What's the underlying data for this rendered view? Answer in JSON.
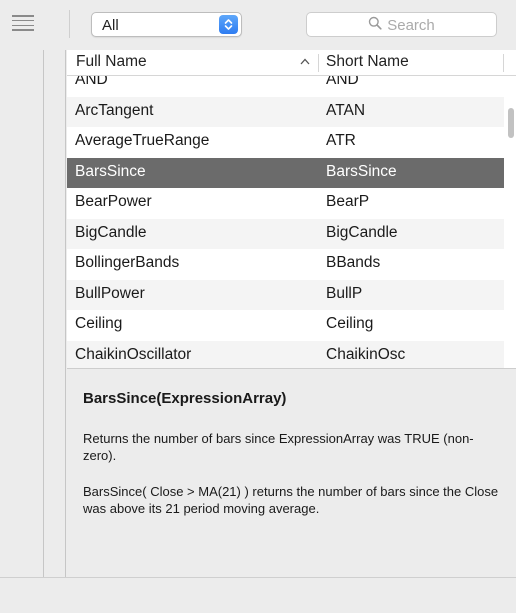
{
  "toolbar": {
    "filter_value": "All",
    "search_placeholder": "Search"
  },
  "table": {
    "columns": [
      "Full Name",
      "Short Name"
    ],
    "sorted_by": "Full Name",
    "rows": [
      {
        "full": "AND",
        "short": "AND"
      },
      {
        "full": "ArcTangent",
        "short": "ATAN"
      },
      {
        "full": "AverageTrueRange",
        "short": "ATR"
      },
      {
        "full": "BarsSince",
        "short": "BarsSince",
        "selected": true
      },
      {
        "full": "BearPower",
        "short": "BearP"
      },
      {
        "full": "BigCandle",
        "short": "BigCandle"
      },
      {
        "full": "BollingerBands",
        "short": "BBands"
      },
      {
        "full": "BullPower",
        "short": "BullP"
      },
      {
        "full": "Ceiling",
        "short": "Ceiling"
      },
      {
        "full": "ChaikinOscillator",
        "short": "ChaikinOsc"
      }
    ]
  },
  "description": {
    "title": "BarsSince(ExpressionArray)",
    "paragraph1": "Returns the number of bars since ExpressionArray was TRUE (non-zero).",
    "paragraph2": "BarsSince( Close > MA(21) ) returns the number of bars since the Close was above its 21 period moving average."
  },
  "icons": {
    "sidebar_toggle": "list-icon",
    "popup_arrows": "chevron-up-down-icon",
    "search": "magnifier-icon",
    "sort": "sort-ascending-icon"
  },
  "colors": {
    "selected_row": "#6b6b6b",
    "popup_accent": "#2e7cf1"
  }
}
